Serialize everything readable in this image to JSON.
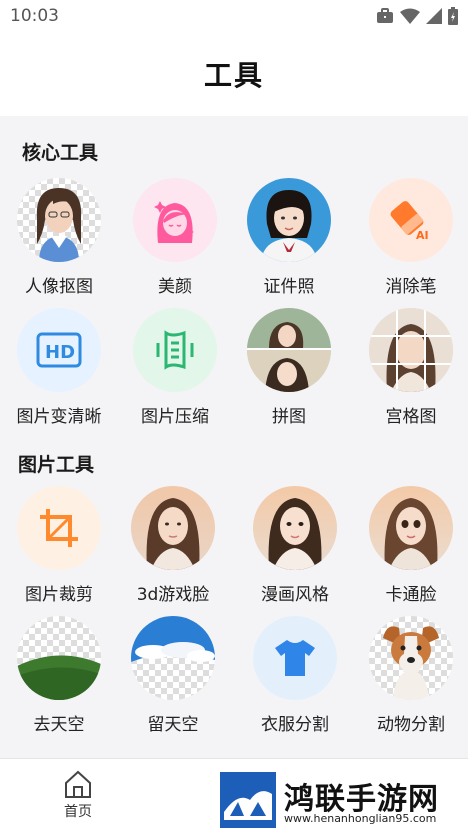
{
  "status_bar": {
    "time": "10:03",
    "icons": [
      "briefcase-icon",
      "wifi-icon",
      "signal-icon",
      "battery-icon"
    ]
  },
  "header": {
    "title": "工具"
  },
  "sections": {
    "core": {
      "title": "核心工具",
      "items": [
        {
          "label": "人像抠图",
          "icon": "portrait-cutout-thumbnail"
        },
        {
          "label": "美颜",
          "icon": "beauty-face-icon"
        },
        {
          "label": "证件照",
          "icon": "id-photo-thumbnail"
        },
        {
          "label": "消除笔",
          "icon": "eraser-ai-icon"
        },
        {
          "label": "图片变清晰",
          "icon": "hd-icon"
        },
        {
          "label": "图片压缩",
          "icon": "compress-icon"
        },
        {
          "label": "拼图",
          "icon": "collage-thumbnail"
        },
        {
          "label": "宫格图",
          "icon": "grid-photo-thumbnail"
        }
      ]
    },
    "image": {
      "title": "图片工具",
      "items": [
        {
          "label": "图片裁剪",
          "icon": "crop-icon"
        },
        {
          "label": "3d游戏脸",
          "icon": "3d-face-thumbnail"
        },
        {
          "label": "漫画风格",
          "icon": "comic-style-thumbnail"
        },
        {
          "label": "卡通脸",
          "icon": "cartoon-face-thumbnail"
        },
        {
          "label": "去天空",
          "icon": "remove-sky-thumbnail"
        },
        {
          "label": "留天空",
          "icon": "keep-sky-thumbnail"
        },
        {
          "label": "衣服分割",
          "icon": "tshirt-icon"
        },
        {
          "label": "动物分割",
          "icon": "dog-thumbnail"
        }
      ]
    }
  },
  "bottom_nav": {
    "home_label": "首页"
  },
  "watermark": {
    "title": "鸿联手游网",
    "url": "www.henanhonglian95.com"
  },
  "colors": {
    "accent_orange": "#ff8a3d",
    "pink": "#ff5a9e",
    "blue": "#2f8be0",
    "green": "#2bb673",
    "tshirt_blue": "#2f86e8"
  }
}
